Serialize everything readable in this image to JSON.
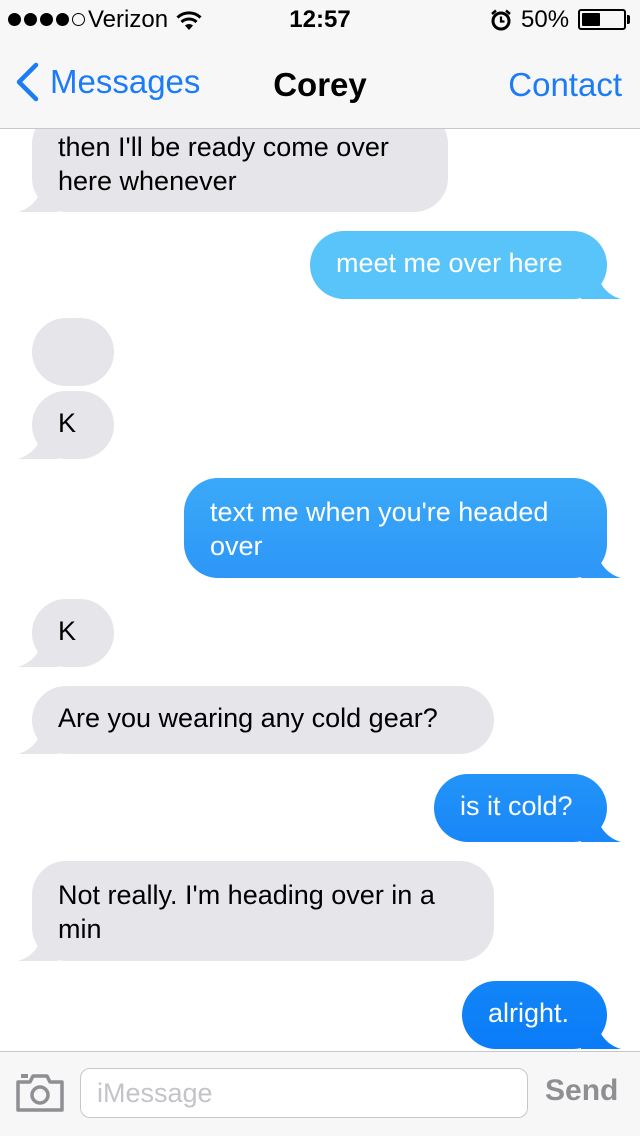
{
  "status_bar": {
    "signal_bars_filled": 4,
    "signal_bars_total": 5,
    "carrier": "Verizon",
    "time": "12:57",
    "battery_percent": "50%",
    "battery_level": 0.5
  },
  "nav": {
    "back_label": "Messages",
    "title": "Corey",
    "right_label": "Contact"
  },
  "messages": [
    {
      "direction": "incoming",
      "text": "then I'll be ready come over here whenever"
    },
    {
      "direction": "outgoing",
      "text": "meet me over here"
    },
    {
      "direction": "incoming",
      "text": ""
    },
    {
      "direction": "incoming",
      "text": "K"
    },
    {
      "direction": "outgoing",
      "text": "text me when you're headed over"
    },
    {
      "direction": "incoming",
      "text": "K"
    },
    {
      "direction": "incoming",
      "text": "Are you wearing any cold gear?"
    },
    {
      "direction": "outgoing",
      "text": "is it cold?"
    },
    {
      "direction": "incoming",
      "text": "Not really. I'm heading over in a min"
    },
    {
      "direction": "outgoing",
      "text": "alright."
    }
  ],
  "compose": {
    "placeholder": "iMessage",
    "send_label": "Send"
  },
  "colors": {
    "accent": "#1b7cf6",
    "incoming_bubble": "#e5e5ea",
    "outgoing_gradient_top": "#5ac8fa",
    "outgoing_gradient_bottom": "#0a7cf8"
  },
  "icons": {
    "back": "chevron-left-icon",
    "wifi": "wifi-icon",
    "alarm": "alarm-clock-icon",
    "camera": "camera-icon"
  }
}
